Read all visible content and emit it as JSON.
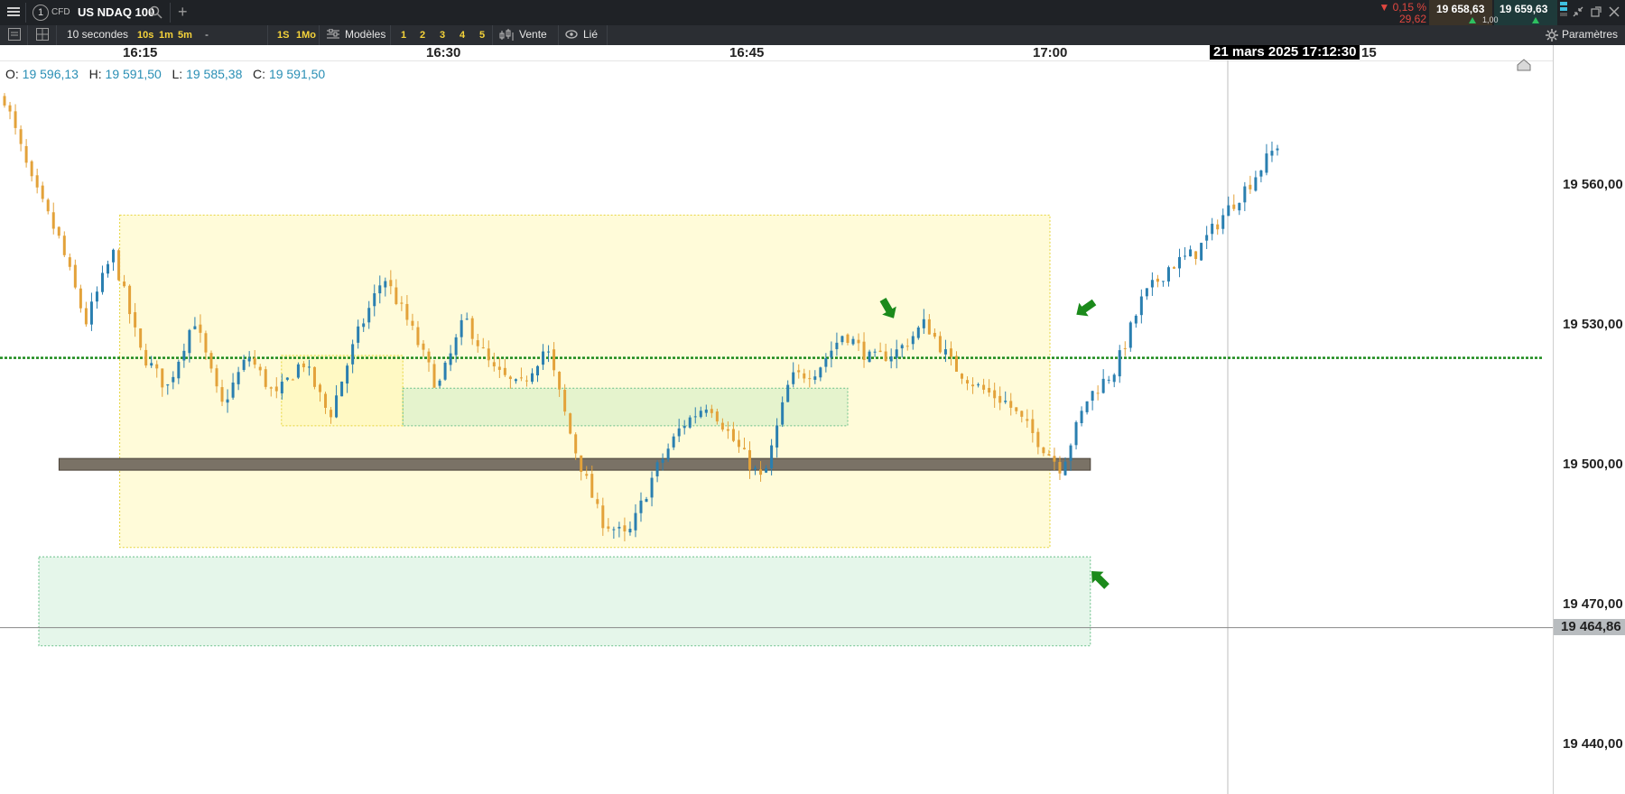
{
  "window": {
    "number": "1",
    "asset_type": "CFD",
    "instrument": "US NDAQ 100"
  },
  "quote": {
    "change_pct": "▼ 0,15 %",
    "change_abs": "29,62",
    "bid": "19 658,63",
    "ask": "19 659,63",
    "spread": "1,00"
  },
  "toolbar": {
    "interval": "10 secondes",
    "quick_intervals": [
      "10s",
      "1m",
      "5m"
    ],
    "dash": "-",
    "ranges": [
      "1S",
      "1Mo"
    ],
    "templates_label": "Modèles",
    "layout_buttons": [
      "1",
      "2",
      "3",
      "4",
      "5"
    ],
    "order_label": "Vente",
    "link_label": "Lié",
    "settings_label": "Paramètres"
  },
  "time_axis": {
    "labels": [
      "16:15",
      "16:30",
      "16:45",
      "17:00"
    ],
    "cursor_label": "21 mars 2025 17:12:30",
    "after_cursor": "15"
  },
  "ohlc": {
    "o_label": "O:",
    "o_value": "19 596,13",
    "h_label": "H:",
    "h_value": "19 591,50",
    "l_label": "L:",
    "l_value": "19 585,38",
    "c_label": "C:",
    "c_value": "19 591,50"
  },
  "price_axis": {
    "labels": [
      "19 560,00",
      "19 530,00",
      "19 500,00",
      "19 470,00",
      "19 440,00"
    ],
    "current": "19 464,86"
  },
  "chart_data": {
    "type": "candlestick",
    "x_range": [
      "16:10",
      "17:18"
    ],
    "y_range": [
      19428,
      19588
    ],
    "close_path": [
      19578,
      19560,
      19548,
      19530,
      19545,
      19524,
      19516,
      19531,
      19512,
      19523,
      19514,
      19522,
      19510,
      19527,
      19540,
      19529,
      19516,
      19531,
      19520,
      19516,
      19525,
      19504,
      19488,
      19484,
      19498,
      19508,
      19513,
      19504,
      19496,
      19518,
      19520,
      19528,
      19522,
      19524,
      19530,
      19521,
      19516,
      19513,
      19506,
      19499,
      19514,
      19520,
      19535,
      19542,
      19545,
      19553,
      19560,
      19568
    ],
    "colors": {
      "up": "#2a7fb0",
      "down": "#e3a23a",
      "grid": "#e6e6e6"
    },
    "overlays": [
      {
        "type": "zone",
        "color": "yellow",
        "from": "16:14",
        "to": "17:00",
        "y_low": 19482,
        "y_high": 19553
      },
      {
        "type": "zone",
        "color": "yellow",
        "from": "16:22",
        "to": "16:28",
        "y_low": 19508,
        "y_high": 19523
      },
      {
        "type": "zone",
        "color": "green",
        "from": "16:28",
        "to": "16:50",
        "y_low": 19508,
        "y_high": 19516
      },
      {
        "type": "band",
        "color": "dark",
        "from": "16:11",
        "to": "17:02",
        "y_low": 19498.5,
        "y_high": 19501
      },
      {
        "type": "zone",
        "color": "green",
        "from": "16:10",
        "to": "17:02",
        "y_low": 19461,
        "y_high": 19480
      },
      {
        "type": "hline",
        "style": "dotted",
        "color": "green",
        "y": 19522.5
      },
      {
        "type": "hline",
        "style": "solid",
        "color": "gray",
        "y": 19464.86
      }
    ]
  }
}
